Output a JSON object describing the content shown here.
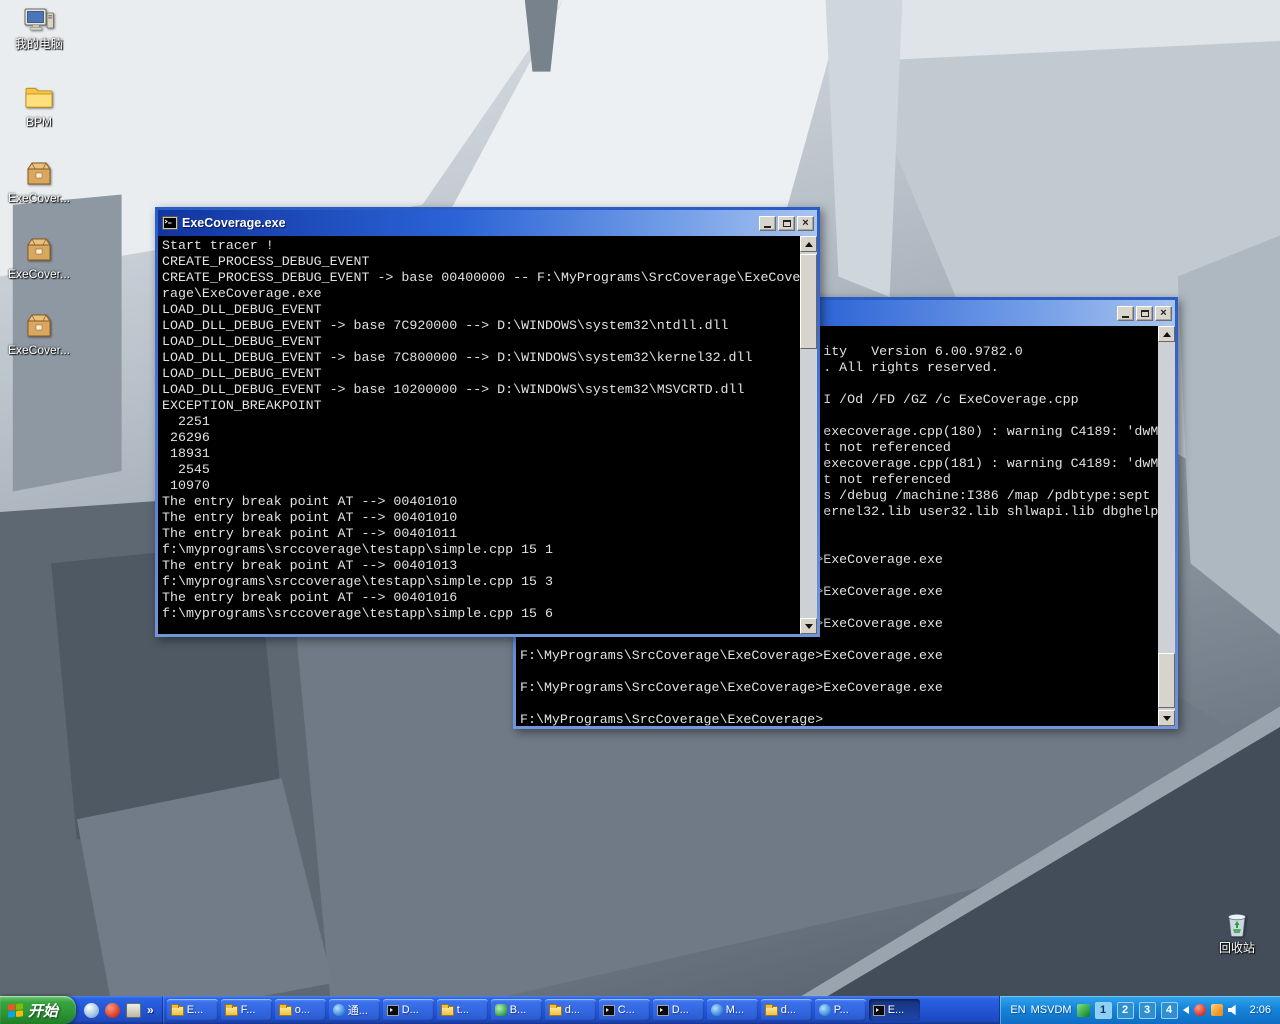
{
  "desktop": {
    "icons": [
      {
        "label": "我的电脑"
      },
      {
        "label": "BPM"
      },
      {
        "label": "ExeCover..."
      },
      {
        "label": "ExeCover..."
      },
      {
        "label": "ExeCover..."
      },
      {
        "label": "回收站"
      }
    ]
  },
  "front_window": {
    "title": "ExeCoverage.exe",
    "lines": [
      "Start tracer !",
      "CREATE_PROCESS_DEBUG_EVENT",
      "CREATE_PROCESS_DEBUG_EVENT -> base 00400000 -- F:\\MyPrograms\\SrcCoverage\\ExeCove",
      "rage\\ExeCoverage.exe",
      "LOAD_DLL_DEBUG_EVENT",
      "LOAD_DLL_DEBUG_EVENT -> base 7C920000 --> D:\\WINDOWS\\system32\\ntdll.dll",
      "LOAD_DLL_DEBUG_EVENT",
      "LOAD_DLL_DEBUG_EVENT -> base 7C800000 --> D:\\WINDOWS\\system32\\kernel32.dll",
      "LOAD_DLL_DEBUG_EVENT",
      "LOAD_DLL_DEBUG_EVENT -> base 10200000 --> D:\\WINDOWS\\system32\\MSVCRTD.dll",
      "EXCEPTION_BREAKPOINT",
      "  2251",
      " 26296",
      " 18931",
      "  2545",
      " 10970",
      "The entry break point AT --> 00401010",
      "The entry break point AT --> 00401010",
      "The entry break point AT --> 00401011",
      "f:\\myprograms\\srccoverage\\testapp\\simple.cpp 15 1",
      "The entry break point AT --> 00401013",
      "f:\\myprograms\\srccoverage\\testapp\\simple.cpp 15 3",
      "The entry break point AT --> 00401016",
      "f:\\myprograms\\srccoverage\\testapp\\simple.cpp 15 6"
    ]
  },
  "back_window": {
    "title": "",
    "lines": [
      "",
      "                                      ity   Version 6.00.9782.0",
      "                                      . All rights reserved.",
      "",
      "                                      I /Od /FD /GZ /c ExeCoverage.cpp",
      "",
      "                                      execoverage.cpp(180) : warning C4189: 'dwM",
      "                                      t not referenced",
      "                                      execoverage.cpp(181) : warning C4189: 'dwM",
      "                                      t not referenced",
      "                                      s /debug /machine:I386 /map /pdbtype:sept",
      "                                      ernel32.lib user32.lib shlwapi.lib dbghelp",
      "",
      "",
      "F:\\MyPrograms\\SrcCoverage\\ExeCoverage>ExeCoverage.exe",
      "",
      "F:\\MyPrograms\\SrcCoverage\\ExeCoverage>ExeCoverage.exe",
      "",
      "F:\\MyPrograms\\SrcCoverage\\ExeCoverage>ExeCoverage.exe",
      "",
      "F:\\MyPrograms\\SrcCoverage\\ExeCoverage>ExeCoverage.exe",
      "",
      "F:\\MyPrograms\\SrcCoverage\\ExeCoverage>ExeCoverage.exe",
      "",
      "F:\\MyPrograms\\SrcCoverage\\ExeCoverage>"
    ]
  },
  "taskbar": {
    "start_label": "开始",
    "quick_launch_more": "»",
    "buttons": [
      {
        "label": "E..."
      },
      {
        "label": "F..."
      },
      {
        "label": "o..."
      },
      {
        "label": "通..."
      },
      {
        "label": "D..."
      },
      {
        "label": "t..."
      },
      {
        "label": "B..."
      },
      {
        "label": "d..."
      },
      {
        "label": "C..."
      },
      {
        "label": "D..."
      },
      {
        "label": "M..."
      },
      {
        "label": "d..."
      },
      {
        "label": "P..."
      },
      {
        "label": "E..."
      }
    ],
    "tray": {
      "language": "EN",
      "vdm_label": "MSVDM",
      "desktop_badges": [
        "1",
        "2",
        "3",
        "4"
      ],
      "clock": "2:06"
    }
  }
}
